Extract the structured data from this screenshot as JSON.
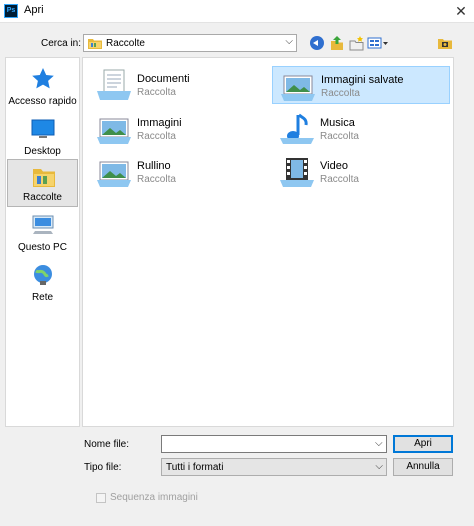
{
  "window": {
    "title": "Apri",
    "app_icon_text": "Ps",
    "close_glyph": "✕"
  },
  "lookin": {
    "label": "Cerca in:",
    "value": "Raccolte"
  },
  "places": [
    {
      "label": "Accesso rapido",
      "icon": "star-icon"
    },
    {
      "label": "Desktop",
      "icon": "desktop-icon"
    },
    {
      "label": "Raccolte",
      "icon": "libraries-icon",
      "selected": true
    },
    {
      "label": "Questo PC",
      "icon": "computer-icon"
    },
    {
      "label": "Rete",
      "icon": "network-icon"
    }
  ],
  "items": [
    {
      "name": "Documenti",
      "sub": "Raccolta",
      "icon": "documents-library-icon"
    },
    {
      "name": "Immagini salvate",
      "sub": "Raccolta",
      "icon": "pictures-library-icon",
      "selected": true
    },
    {
      "name": "Immagini",
      "sub": "Raccolta",
      "icon": "pictures-library-icon"
    },
    {
      "name": "Musica",
      "sub": "Raccolta",
      "icon": "music-library-icon"
    },
    {
      "name": "Rullino",
      "sub": "Raccolta",
      "icon": "pictures-library-icon"
    },
    {
      "name": "Video",
      "sub": "Raccolta",
      "icon": "video-library-icon"
    }
  ],
  "footer": {
    "filename_label": "Nome file:",
    "filename_value": "",
    "filetype_label": "Tipo file:",
    "filetype_value": "Tutti i formati",
    "open_button": "Apri",
    "cancel_button": "Annulla",
    "sequence_label": "Sequenza immagini"
  },
  "colors": {
    "selection": "#cce8ff",
    "selection_border": "#99d1ff",
    "accent": "#0078d7"
  }
}
